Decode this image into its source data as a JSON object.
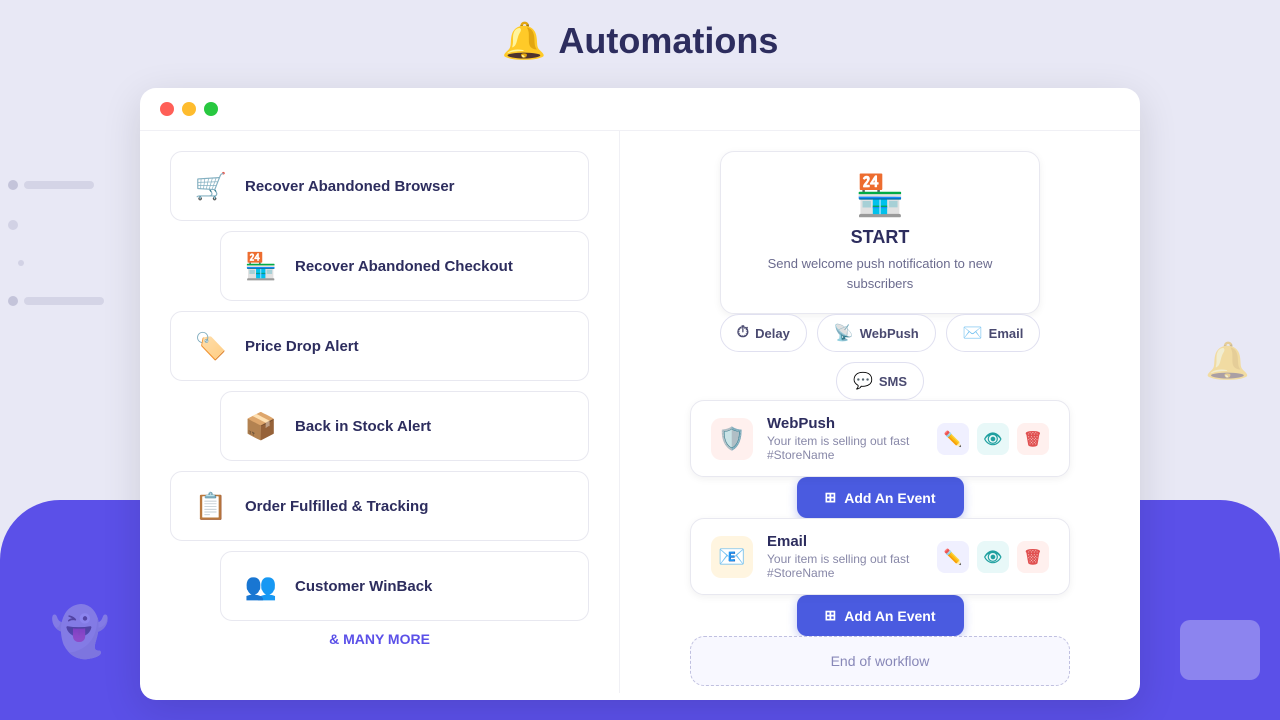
{
  "page": {
    "title": "Automations",
    "bell_icon": "🔔"
  },
  "window": {
    "chrome": {
      "dot_red": "#ff5f57",
      "dot_yellow": "#febc2e",
      "dot_green": "#28c840"
    }
  },
  "left_panel": {
    "items": [
      {
        "id": "recover-abandoned-browser",
        "label": "Recover Abandoned Browser",
        "icon": "🛒",
        "indented": false,
        "selected": false
      },
      {
        "id": "recover-abandoned-checkout",
        "label": "Recover Abandoned Checkout",
        "icon": "🏪",
        "indented": true,
        "selected": false
      },
      {
        "id": "price-drop-alert",
        "label": "Price Drop Alert",
        "icon": "🏷️",
        "indented": false,
        "selected": false
      },
      {
        "id": "back-in-stock",
        "label": "Back in Stock Alert",
        "icon": "📦",
        "indented": true,
        "selected": false
      },
      {
        "id": "order-fulfilled",
        "label": "Order Fulfilled & Tracking",
        "icon": "📋",
        "indented": false,
        "selected": false
      },
      {
        "id": "customer-winback",
        "label": "Customer WinBack",
        "icon": "👥",
        "indented": true,
        "selected": false
      }
    ],
    "many_more_label": "& MANY MORE"
  },
  "right_panel": {
    "start_card": {
      "icon": "🏪",
      "label": "START",
      "description": "Send welcome push notification to new subscribers"
    },
    "action_buttons": [
      {
        "id": "delay",
        "label": "Delay",
        "icon": "⏱"
      },
      {
        "id": "webpush",
        "label": "WebPush",
        "icon": "📡"
      },
      {
        "id": "email",
        "label": "Email",
        "icon": "✉️"
      },
      {
        "id": "sms",
        "label": "SMS",
        "icon": "💬"
      }
    ],
    "events": [
      {
        "id": "webpush-event",
        "type": "WebPush",
        "icon": "🛡️",
        "icon_bg": "webpush",
        "subtitle": "Your item is selling out fast #StoreName"
      },
      {
        "id": "email-event",
        "type": "Email",
        "icon": "📧",
        "icon_bg": "email",
        "subtitle": "Your item is selling out fast #StoreName"
      }
    ],
    "add_event_label": "Add An Event",
    "end_workflow_label": "End of workflow"
  }
}
